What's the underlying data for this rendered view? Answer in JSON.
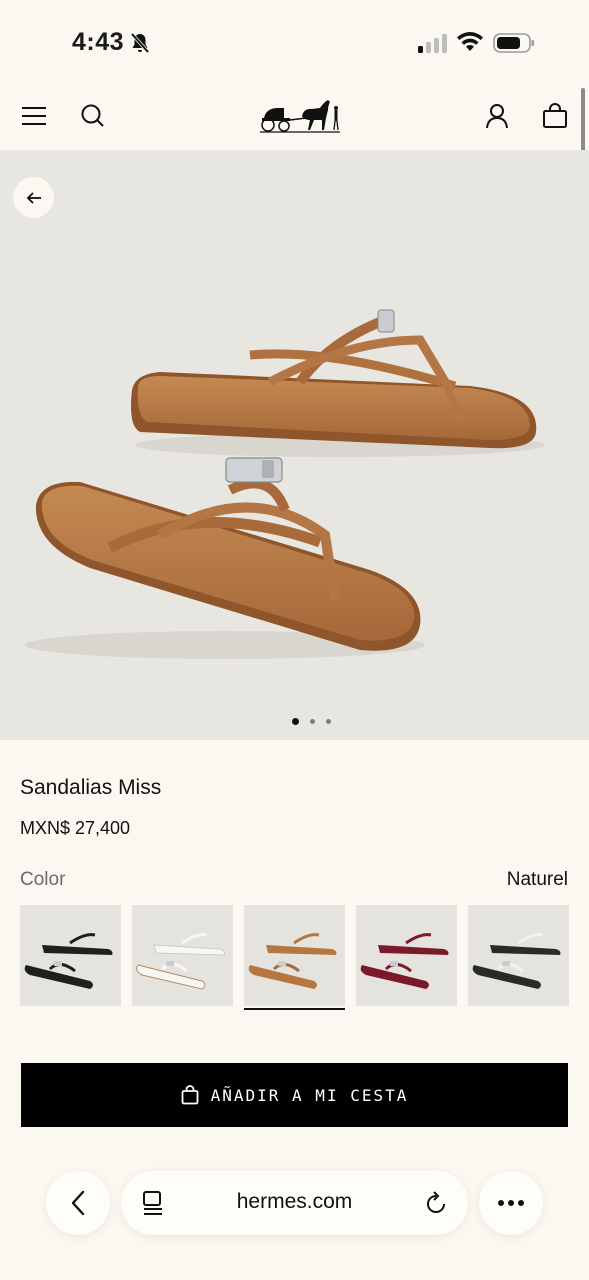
{
  "status_bar": {
    "time": "4:43",
    "icons": [
      "bell-muted-icon",
      "cellular-signal-icon",
      "wifi-icon",
      "battery-icon"
    ]
  },
  "header": {
    "icons": [
      "menu-icon",
      "search-icon",
      "hermes-carriage-logo",
      "account-icon",
      "shopping-bag-icon"
    ]
  },
  "hero": {
    "back_icon": "arrow-left-icon",
    "image_count": 3,
    "active_image": 1
  },
  "product": {
    "title": "Sandalias Miss",
    "price": "MXN$ 27,400",
    "color_label": "Color",
    "color_value": "Naturel",
    "swatches": [
      {
        "name": "Noir",
        "color": "#1f1f1f"
      },
      {
        "name": "Blanc",
        "color": "#f4f4f2"
      },
      {
        "name": "Naturel",
        "color": "#b5773f",
        "selected": true
      },
      {
        "name": "Rouge",
        "color": "#7b1a2a"
      },
      {
        "name": "Noir/Blanc",
        "color": "#2a2a2a"
      }
    ]
  },
  "cart": {
    "add_label": "AÑADIR A MI CESTA",
    "icon": "shopping-bag-icon"
  },
  "browser": {
    "url": "hermes.com",
    "icons": [
      "chevron-left-icon",
      "tabs-icon",
      "reload-icon",
      "more-icon"
    ]
  },
  "colors": {
    "background": "#fbf8f1",
    "hero_background": "#e8e6e0",
    "button": "#000000",
    "accent_leather": "#b5773f"
  }
}
